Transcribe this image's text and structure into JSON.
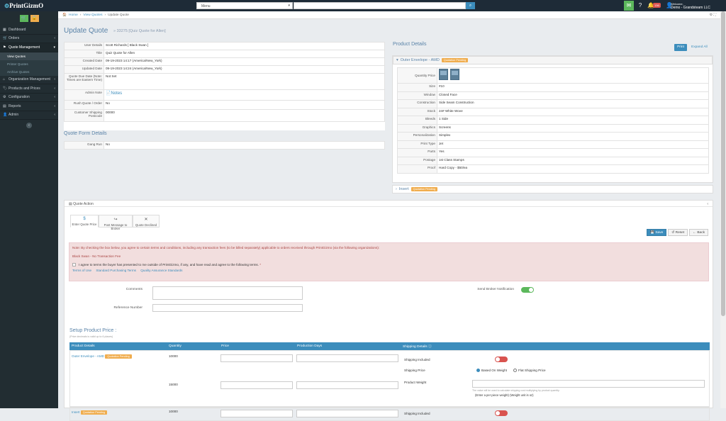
{
  "app": {
    "logo": "PrintGizmO"
  },
  "topbar": {
    "menu_placeholder": "Menu",
    "notification_count": "136",
    "welcome_label": "Welcome,",
    "user_name": "Demo - Grandsteam LLC"
  },
  "sidebar": {
    "items": [
      {
        "label": "Dashboard",
        "icon": "dashboard-icon"
      },
      {
        "label": "Orders",
        "icon": "cart-icon"
      },
      {
        "label": "Quote Management",
        "icon": "quote-icon"
      },
      {
        "label": "Organization Management",
        "icon": "org-icon"
      },
      {
        "label": "Products and Prices",
        "icon": "tag-icon"
      },
      {
        "label": "Configuration",
        "icon": "gear-icon"
      },
      {
        "label": "Reports",
        "icon": "chart-icon"
      },
      {
        "label": "Admin",
        "icon": "user-icon"
      }
    ],
    "subitems": [
      "View Quotes",
      "Printer Quotes",
      "Archive Quotes"
    ]
  },
  "breadcrumb": {
    "home": "Home",
    "view_quotes": "View Quotes",
    "current": "Update Quote"
  },
  "page": {
    "title": "Update Quote",
    "subtitle": "» 33275 [Quiz Quote for Allen]"
  },
  "details": {
    "user_details_k": "User Details",
    "user_details_v": "Scott Richards  [ Black Swan ]",
    "title_k": "Title",
    "title_v": "Quiz Quote for Allen",
    "created_k": "Created Date",
    "created_v": "09-19-2023 14:17 (America/New_York)",
    "updated_k": "Updated Date",
    "updated_v": "09-19-2023 14:24 (America/New_York)",
    "due_k": "Quote Due Date (Note: Times are Eastern Time)",
    "due_v": "Not Set",
    "admin_note_k": "Admin Note",
    "admin_note_v": "Notes",
    "rush_k": "Rush Quote / Order",
    "rush_v": "No",
    "postcode_k": "Customer Shipping Postcode",
    "postcode_v": "00000"
  },
  "quote_form": {
    "title": "Quote Form Details",
    "gang_k": "Gang Run",
    "gang_v": "No"
  },
  "product": {
    "title": "Product Details",
    "print_btn": "Print",
    "expand_btn": "Expand All",
    "outer_name": "Outer Envelope - AMD",
    "status": "Quotation Pending",
    "qty_label": "Quantity Price",
    "specs": [
      {
        "k": "Size",
        "v": "#10"
      },
      {
        "k": "Window",
        "v": "Closed Face"
      },
      {
        "k": "Construction",
        "v": "Side Seam Construction"
      },
      {
        "k": "Stock",
        "v": "24# White Wove"
      },
      {
        "k": "Bleeds",
        "v": "1 Side"
      },
      {
        "k": "Graphics",
        "v": "Screens"
      },
      {
        "k": "Personalization",
        "v": "Simplex"
      },
      {
        "k": "Print Type",
        "v": "Jet"
      },
      {
        "k": "Parts",
        "v": "Yes"
      },
      {
        "k": "Postage",
        "v": "1st Class Stamps"
      },
      {
        "k": "Proof",
        "v": "Hard Copy - $50/ea"
      }
    ],
    "insert_name": "Insert"
  },
  "quote_action": {
    "title": "Quote Action",
    "tabs": [
      {
        "icon": "$",
        "label": "Enter Quote Price"
      },
      {
        "icon": "↪",
        "label": "Post Message to Broker"
      },
      {
        "icon": "✕",
        "label": "Quote Declined"
      }
    ],
    "save": "Save",
    "reset": "Reset",
    "back": "Back",
    "note": "Note: By checking the box below, you agree to certain terms and conditions, including any transaction fees (to be billed separately) applicable to orders received through PrintGizmo (via the following organizations):",
    "org_line": "Black Swan - No Transaction Fee",
    "agree": "I agree to terms the buyer has presented to me outside of PrintGizmo, if any, and have read and agree to the following terms.",
    "required": "*",
    "links": [
      "Terms of Use",
      "Standard Purchasing Terms",
      "Quality Assurance Standards"
    ],
    "comments_label": "Comments",
    "reference_label": "Reference Number",
    "notify_label": "Send Broker Notification"
  },
  "setup": {
    "title": "Setup Product Price :",
    "subtitle": "(Price decimals is valid up to 6 places)",
    "headers": [
      "Product Details",
      "Quantity",
      "Price",
      "Production Days",
      "Shipping Details"
    ],
    "row1_product": "Outer Envelope - AMD",
    "row1_status": "Quotation Pending",
    "q1": "10000",
    "q2": "15000",
    "ship_included": "Shipping Included",
    "ship_price": "Shipping Price",
    "opt_weight": "Based On Weight",
    "opt_flat": "Flat Shipping Price",
    "product_weight": "Product Weight",
    "weight_note": "The value will be used to calculate shipping cost multiplying by product quantity.",
    "weight_hint": "(Enter a per piece weight) (Weight unit is oz)",
    "row2_product": "Insert",
    "row2_status": "Quotation Pending",
    "q3": "10000",
    "ship_included2": "Shipping Included"
  }
}
